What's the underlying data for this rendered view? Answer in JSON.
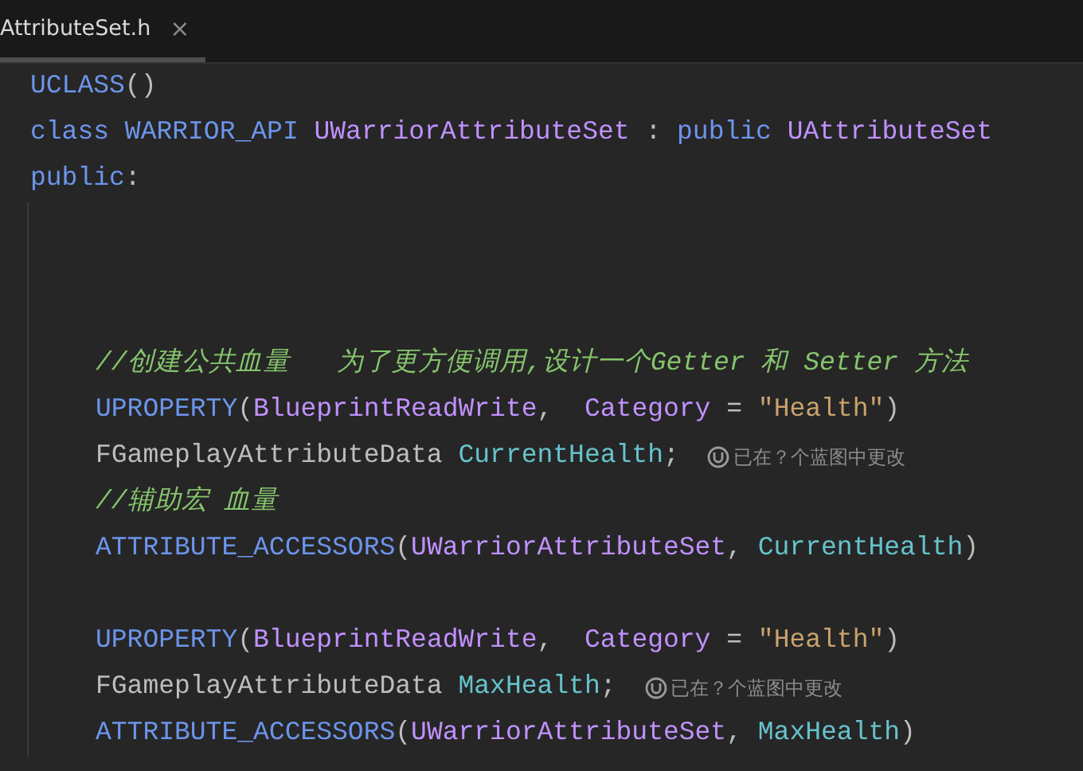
{
  "tab": {
    "title": "AttributeSet.h",
    "close": "×",
    "selected": true
  },
  "lines": [
    {
      "kind": "code",
      "tokens": [
        {
          "text": "UCLASS",
          "kind": "macro"
        },
        {
          "text": "()",
          "kind": "plain"
        }
      ]
    },
    {
      "kind": "code",
      "tokens": [
        {
          "text": "class ",
          "kind": "keyword"
        },
        {
          "text": "WARRIOR_API ",
          "kind": "macro"
        },
        {
          "text": "UWarriorAttributeSet",
          "kind": "type"
        },
        {
          "text": " : ",
          "kind": "plain"
        },
        {
          "text": "public ",
          "kind": "keyword"
        },
        {
          "text": "UAttributeSet",
          "kind": "type"
        }
      ]
    },
    {
      "kind": "code",
      "tokens": [
        {
          "text": "public",
          "kind": "keyword"
        },
        {
          "text": ":",
          "kind": "plain"
        }
      ],
      "children": [
        {
          "kind": "blank"
        },
        {
          "kind": "blank"
        },
        {
          "kind": "blank"
        },
        {
          "kind": "code",
          "tokens": [
            {
              "text": "//创建公共血量   为了更方便调用,设计一个Getter 和 Setter 方法",
              "kind": "comment"
            }
          ]
        },
        {
          "kind": "code",
          "tokens": [
            {
              "text": "UPROPERTY",
              "kind": "macro"
            },
            {
              "text": "(",
              "kind": "plain"
            },
            {
              "text": "BlueprintReadWrite",
              "kind": "type"
            },
            {
              "text": ",  ",
              "kind": "plain"
            },
            {
              "text": "Category",
              "kind": "type"
            },
            {
              "text": " = ",
              "kind": "plain"
            },
            {
              "text": "\"Health\"",
              "kind": "string"
            },
            {
              "text": ")",
              "kind": "plain"
            }
          ]
        },
        {
          "kind": "code",
          "tokens": [
            {
              "text": "FGameplayAttributeData ",
              "kind": "plain"
            },
            {
              "text": "CurrentHealth",
              "kind": "field"
            },
            {
              "text": ";",
              "kind": "plain"
            }
          ],
          "hint": "已在？个蓝图中更改"
        },
        {
          "kind": "code",
          "tokens": [
            {
              "text": "//辅助宏 血量",
              "kind": "comment"
            }
          ]
        },
        {
          "kind": "code",
          "tokens": [
            {
              "text": "ATTRIBUTE_ACCESSORS",
              "kind": "macro"
            },
            {
              "text": "(",
              "kind": "plain"
            },
            {
              "text": "UWarriorAttributeSet",
              "kind": "type"
            },
            {
              "text": ", ",
              "kind": "plain"
            },
            {
              "text": "CurrentHealth",
              "kind": "field"
            },
            {
              "text": ")",
              "kind": "plain"
            }
          ]
        },
        {
          "kind": "blank"
        },
        {
          "kind": "code",
          "tokens": [
            {
              "text": "UPROPERTY",
              "kind": "macro"
            },
            {
              "text": "(",
              "kind": "plain"
            },
            {
              "text": "BlueprintReadWrite",
              "kind": "type"
            },
            {
              "text": ",  ",
              "kind": "plain"
            },
            {
              "text": "Category",
              "kind": "type"
            },
            {
              "text": " = ",
              "kind": "plain"
            },
            {
              "text": "\"Health\"",
              "kind": "string"
            },
            {
              "text": ")",
              "kind": "plain"
            }
          ]
        },
        {
          "kind": "code",
          "tokens": [
            {
              "text": "FGameplayAttributeData ",
              "kind": "plain"
            },
            {
              "text": "MaxHealth",
              "kind": "field"
            },
            {
              "text": ";",
              "kind": "plain"
            }
          ],
          "hint": "已在？个蓝图中更改"
        },
        {
          "kind": "code",
          "tokens": [
            {
              "text": "ATTRIBUTE_ACCESSORS",
              "kind": "macro"
            },
            {
              "text": "(",
              "kind": "plain"
            },
            {
              "text": "UWarriorAttributeSet",
              "kind": "type"
            },
            {
              "text": ", ",
              "kind": "plain"
            },
            {
              "text": "MaxHealth",
              "kind": "field"
            },
            {
              "text": ")",
              "kind": "plain"
            }
          ]
        }
      ]
    }
  ]
}
